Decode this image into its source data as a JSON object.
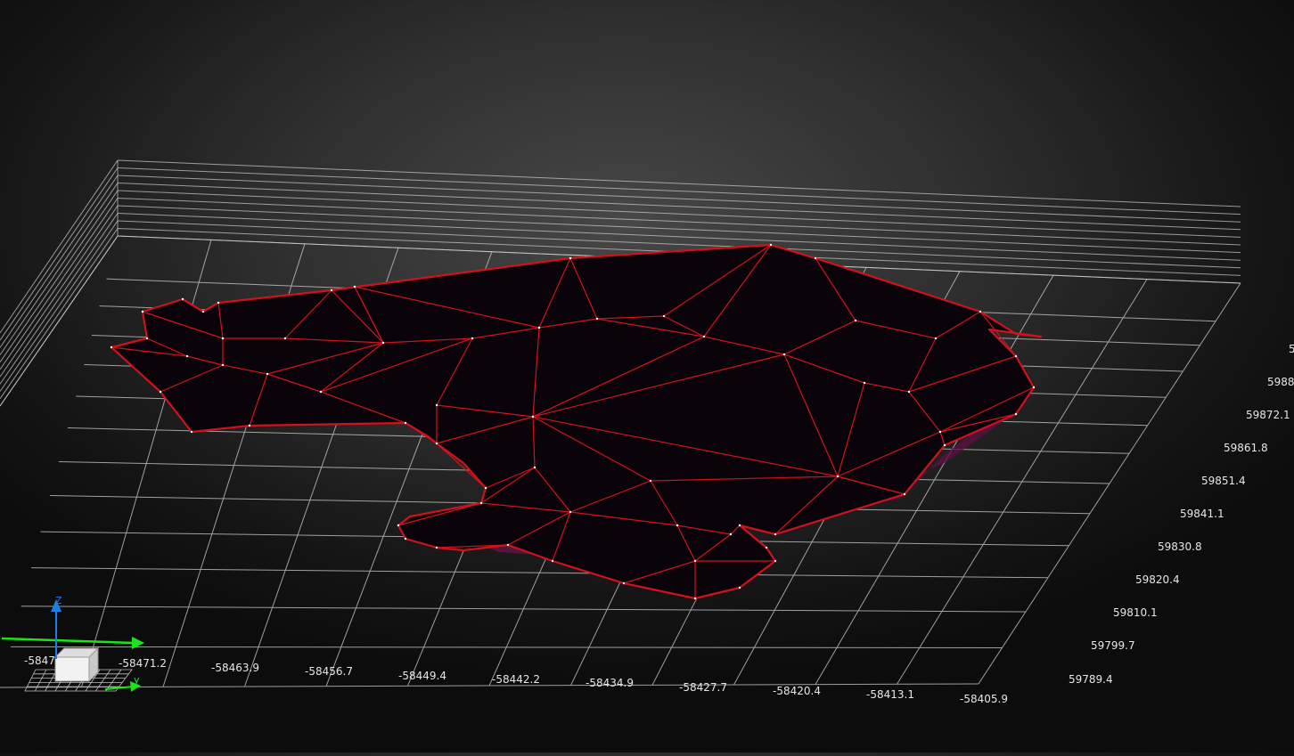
{
  "viewer": {
    "x_axis_ticks": [
      "-58471.2",
      "-58463.9",
      "-58456.7",
      "-58449.4",
      "-58442.2",
      "-58434.9",
      "-58427.7",
      "-58420.4",
      "-58413.1",
      "-58405.9"
    ],
    "x_axis_ticks_partial": [
      "-5847"
    ],
    "y_axis_ticks": [
      "59789.4",
      "59799.7",
      "59810.1",
      "59820.4",
      "59830.8",
      "59841.1",
      "59851.4",
      "59861.8",
      "59872.1",
      "5988"
    ],
    "y_axis_ticks_partial": [
      "5"
    ],
    "gizmo": {
      "z_label": "Z",
      "y_label": "y"
    },
    "colors": {
      "background": "#2e2e2e",
      "grid": "#cfcfcf",
      "mesh_edge": "#d1121d",
      "mesh_fill": "#0a0309",
      "mesh_side": "#5a1040",
      "axis_x": "#19e619",
      "axis_z": "#1c7fe6"
    }
  }
}
